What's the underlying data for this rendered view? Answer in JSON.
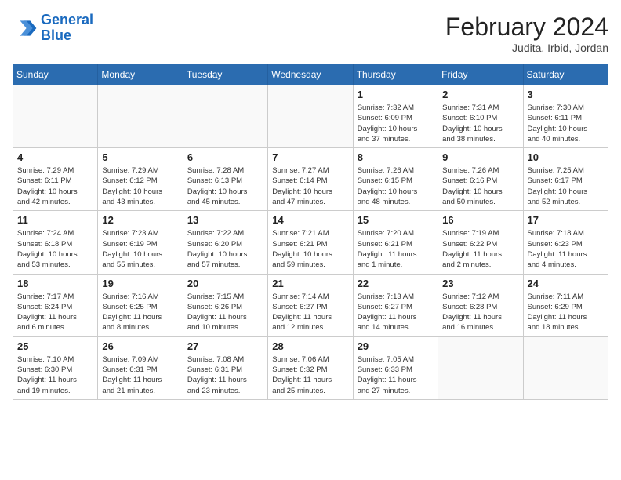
{
  "header": {
    "logo_line1": "General",
    "logo_line2": "Blue",
    "month_year": "February 2024",
    "location": "Judita, Irbid, Jordan"
  },
  "weekdays": [
    "Sunday",
    "Monday",
    "Tuesday",
    "Wednesday",
    "Thursday",
    "Friday",
    "Saturday"
  ],
  "weeks": [
    [
      {
        "day": "",
        "info": ""
      },
      {
        "day": "",
        "info": ""
      },
      {
        "day": "",
        "info": ""
      },
      {
        "day": "",
        "info": ""
      },
      {
        "day": "1",
        "info": "Sunrise: 7:32 AM\nSunset: 6:09 PM\nDaylight: 10 hours\nand 37 minutes."
      },
      {
        "day": "2",
        "info": "Sunrise: 7:31 AM\nSunset: 6:10 PM\nDaylight: 10 hours\nand 38 minutes."
      },
      {
        "day": "3",
        "info": "Sunrise: 7:30 AM\nSunset: 6:11 PM\nDaylight: 10 hours\nand 40 minutes."
      }
    ],
    [
      {
        "day": "4",
        "info": "Sunrise: 7:29 AM\nSunset: 6:11 PM\nDaylight: 10 hours\nand 42 minutes."
      },
      {
        "day": "5",
        "info": "Sunrise: 7:29 AM\nSunset: 6:12 PM\nDaylight: 10 hours\nand 43 minutes."
      },
      {
        "day": "6",
        "info": "Sunrise: 7:28 AM\nSunset: 6:13 PM\nDaylight: 10 hours\nand 45 minutes."
      },
      {
        "day": "7",
        "info": "Sunrise: 7:27 AM\nSunset: 6:14 PM\nDaylight: 10 hours\nand 47 minutes."
      },
      {
        "day": "8",
        "info": "Sunrise: 7:26 AM\nSunset: 6:15 PM\nDaylight: 10 hours\nand 48 minutes."
      },
      {
        "day": "9",
        "info": "Sunrise: 7:26 AM\nSunset: 6:16 PM\nDaylight: 10 hours\nand 50 minutes."
      },
      {
        "day": "10",
        "info": "Sunrise: 7:25 AM\nSunset: 6:17 PM\nDaylight: 10 hours\nand 52 minutes."
      }
    ],
    [
      {
        "day": "11",
        "info": "Sunrise: 7:24 AM\nSunset: 6:18 PM\nDaylight: 10 hours\nand 53 minutes."
      },
      {
        "day": "12",
        "info": "Sunrise: 7:23 AM\nSunset: 6:19 PM\nDaylight: 10 hours\nand 55 minutes."
      },
      {
        "day": "13",
        "info": "Sunrise: 7:22 AM\nSunset: 6:20 PM\nDaylight: 10 hours\nand 57 minutes."
      },
      {
        "day": "14",
        "info": "Sunrise: 7:21 AM\nSunset: 6:21 PM\nDaylight: 10 hours\nand 59 minutes."
      },
      {
        "day": "15",
        "info": "Sunrise: 7:20 AM\nSunset: 6:21 PM\nDaylight: 11 hours\nand 1 minute."
      },
      {
        "day": "16",
        "info": "Sunrise: 7:19 AM\nSunset: 6:22 PM\nDaylight: 11 hours\nand 2 minutes."
      },
      {
        "day": "17",
        "info": "Sunrise: 7:18 AM\nSunset: 6:23 PM\nDaylight: 11 hours\nand 4 minutes."
      }
    ],
    [
      {
        "day": "18",
        "info": "Sunrise: 7:17 AM\nSunset: 6:24 PM\nDaylight: 11 hours\nand 6 minutes."
      },
      {
        "day": "19",
        "info": "Sunrise: 7:16 AM\nSunset: 6:25 PM\nDaylight: 11 hours\nand 8 minutes."
      },
      {
        "day": "20",
        "info": "Sunrise: 7:15 AM\nSunset: 6:26 PM\nDaylight: 11 hours\nand 10 minutes."
      },
      {
        "day": "21",
        "info": "Sunrise: 7:14 AM\nSunset: 6:27 PM\nDaylight: 11 hours\nand 12 minutes."
      },
      {
        "day": "22",
        "info": "Sunrise: 7:13 AM\nSunset: 6:27 PM\nDaylight: 11 hours\nand 14 minutes."
      },
      {
        "day": "23",
        "info": "Sunrise: 7:12 AM\nSunset: 6:28 PM\nDaylight: 11 hours\nand 16 minutes."
      },
      {
        "day": "24",
        "info": "Sunrise: 7:11 AM\nSunset: 6:29 PM\nDaylight: 11 hours\nand 18 minutes."
      }
    ],
    [
      {
        "day": "25",
        "info": "Sunrise: 7:10 AM\nSunset: 6:30 PM\nDaylight: 11 hours\nand 19 minutes."
      },
      {
        "day": "26",
        "info": "Sunrise: 7:09 AM\nSunset: 6:31 PM\nDaylight: 11 hours\nand 21 minutes."
      },
      {
        "day": "27",
        "info": "Sunrise: 7:08 AM\nSunset: 6:31 PM\nDaylight: 11 hours\nand 23 minutes."
      },
      {
        "day": "28",
        "info": "Sunrise: 7:06 AM\nSunset: 6:32 PM\nDaylight: 11 hours\nand 25 minutes."
      },
      {
        "day": "29",
        "info": "Sunrise: 7:05 AM\nSunset: 6:33 PM\nDaylight: 11 hours\nand 27 minutes."
      },
      {
        "day": "",
        "info": ""
      },
      {
        "day": "",
        "info": ""
      }
    ]
  ]
}
